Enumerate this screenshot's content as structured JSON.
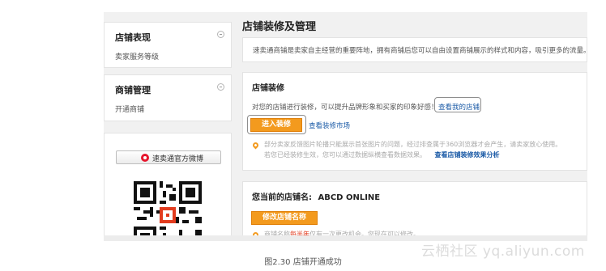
{
  "sidebar": {
    "groups": [
      {
        "title": "店铺表现",
        "item": "卖家服务等级"
      },
      {
        "title": "商铺管理",
        "item": "开通商铺"
      }
    ],
    "weibo_label": "速卖通官方微博"
  },
  "main": {
    "page_title": "店铺装修及管理",
    "intro_text": "速卖通商铺是卖家自主经营的重要阵地，拥有商铺后您可以自由设置商铺展示的样式和内容，吸引更多的流量。",
    "decor": {
      "heading": "店铺装修",
      "desc": "对您的店铺进行装修，可以提升品牌形象和买家的印象好感！",
      "view_store_link": "查看我的店铺",
      "enter_button": "进入装修",
      "market_link": "查看装修市场",
      "note_line1": "部分卖家反馈图片轮播只能展示首张图片的问题，经过排查属于360浏览器才会产生，请卖家放心使用。",
      "note_line2": "若您已经装修生效，您可以通过数据纵横查看数据效果。",
      "effect_link": "查看店铺装修效果分析"
    },
    "store": {
      "label": "您当前的店铺名:",
      "name": "ABCD ONLINE",
      "edit_button": "修改店铺名称",
      "note_prefix": "商铺名称",
      "note_highlight": "每半年",
      "note_suffix": "仅有一次更改机会。您现在可以修改。"
    }
  },
  "watermark": "云栖社区 yq.aliyun.com",
  "caption": "图2.30    店铺开通成功",
  "colors": {
    "accent_orange": "#f39a1e",
    "link_blue": "#1a5aa6",
    "weibo_red": "#e6162d"
  }
}
